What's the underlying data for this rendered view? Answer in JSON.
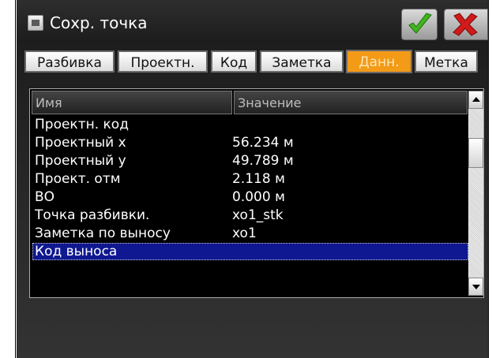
{
  "window": {
    "title": "Сохр. точка"
  },
  "tabs": [
    {
      "label": "Разбивка"
    },
    {
      "label": "Проектн."
    },
    {
      "label": "Код"
    },
    {
      "label": "Заметка"
    },
    {
      "label": "Данн.",
      "active": true
    },
    {
      "label": "Метка"
    }
  ],
  "table": {
    "headers": {
      "name": "Имя",
      "value": "Значение"
    },
    "rows": [
      {
        "name": "Проектн. код",
        "value": ""
      },
      {
        "name": "Проектный x",
        "value": "56.234 м"
      },
      {
        "name": "Проектный y",
        "value": "49.789 м"
      },
      {
        "name": "Проект. отм",
        "value": "2.118 м"
      },
      {
        "name": "ВО",
        "value": "0.000 м"
      },
      {
        "name": "Точка разбивки.",
        "value": "xo1_stk"
      },
      {
        "name": "Заметка по выносу",
        "value": "xo1"
      },
      {
        "name": "Код выноса",
        "value": "",
        "selected": true
      }
    ]
  },
  "icons": {
    "app": "device-icon",
    "ok": "checkmark-icon",
    "cancel": "close-icon",
    "scroll_up": "arrow-up-icon",
    "scroll_down": "arrow-down-icon"
  },
  "colors": {
    "active_tab": "#f39a17",
    "selection": "#0f1890",
    "ok_green": "#3fb51e",
    "cancel_red": "#d11a1a"
  }
}
